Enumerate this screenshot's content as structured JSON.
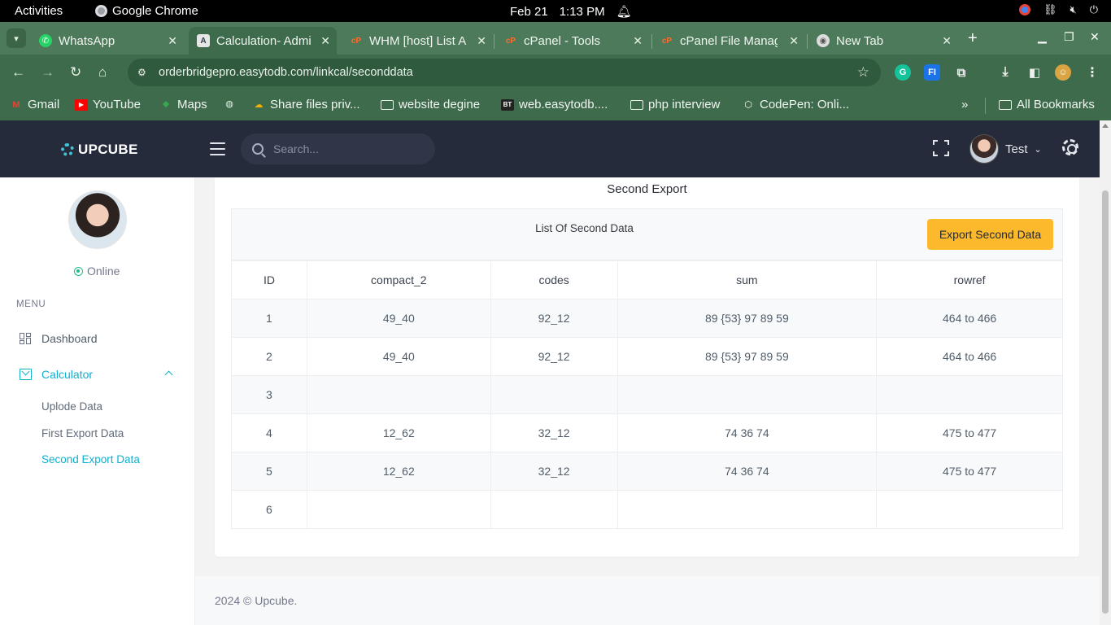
{
  "os_bar": {
    "activities": "Activities",
    "app_name": "Google Chrome",
    "date": "Feb 21",
    "time": "1:13 PM"
  },
  "tabs": [
    {
      "label": "WhatsApp",
      "icon": "whatsapp-icon",
      "color": "#25d366",
      "active": false
    },
    {
      "label": "Calculation- Admi",
      "icon": "a-icon",
      "color": "#2c3e50",
      "active": true
    },
    {
      "label": "WHM [host] List A",
      "icon": "cpanel-icon",
      "color": "#ff6c2c",
      "active": false
    },
    {
      "label": "cPanel - Tools",
      "icon": "cpanel-icon",
      "color": "#ff6c2c",
      "active": false
    },
    {
      "label": "cPanel File Manag",
      "icon": "cpanel-icon",
      "color": "#ff6c2c",
      "active": false
    },
    {
      "label": "New Tab",
      "icon": "chrome-icon",
      "color": "#dddddd",
      "active": false
    }
  ],
  "address": {
    "url": "orderbridgepro.easytodb.com/linkcal/seconddata"
  },
  "bookmarks": [
    {
      "label": "Gmail",
      "icon": "gmail-icon"
    },
    {
      "label": "YouTube",
      "icon": "youtube-icon"
    },
    {
      "label": "Maps",
      "icon": "maps-icon"
    },
    {
      "label": "Share files priv...",
      "icon": "share-icon"
    },
    {
      "label": "website degine",
      "icon": "folder-icon"
    },
    {
      "label": "web.easytodb....",
      "icon": "bt-icon"
    },
    {
      "label": "php interview",
      "icon": "folder-icon"
    },
    {
      "label": "CodePen: Onli...",
      "icon": "codepen-icon"
    }
  ],
  "all_bookmarks": "All Bookmarks",
  "header": {
    "brand": "UPCUBE",
    "search_placeholder": "Search...",
    "user_name": "Test"
  },
  "sidebar": {
    "status": "Online",
    "menu_title": "MENU",
    "items": [
      {
        "label": "Dashboard"
      },
      {
        "label": "Calculator"
      }
    ],
    "sub_items": [
      {
        "label": "Uplode Data"
      },
      {
        "label": "First Export Data"
      },
      {
        "label": "Second Export Data"
      }
    ]
  },
  "main": {
    "card_title": "Second Export",
    "list_title": "List Of Second Data",
    "export_button": "Export Second Data",
    "columns": [
      "ID",
      "compact_2",
      "codes",
      "sum",
      "rowref"
    ],
    "rows": [
      [
        "1",
        "49_40",
        "92_12",
        "89 {53} 97 89 59",
        "464 to 466"
      ],
      [
        "2",
        "49_40",
        "92_12",
        "89 {53} 97 89 59",
        "464 to 466"
      ],
      [
        "3",
        "",
        "",
        "",
        ""
      ],
      [
        "4",
        "12_62",
        "32_12",
        "74 36 74",
        "475 to 477"
      ],
      [
        "5",
        "12_62",
        "32_12",
        "74 36 74",
        "475 to 477"
      ],
      [
        "6",
        "",
        "",
        "",
        ""
      ]
    ],
    "footer": "2024 © Upcube."
  },
  "colors": {
    "accent": "#0fb0d0",
    "button": "#fcb92c",
    "header_bg": "#252b3b",
    "chrome_frame": "#3d6b4c"
  }
}
